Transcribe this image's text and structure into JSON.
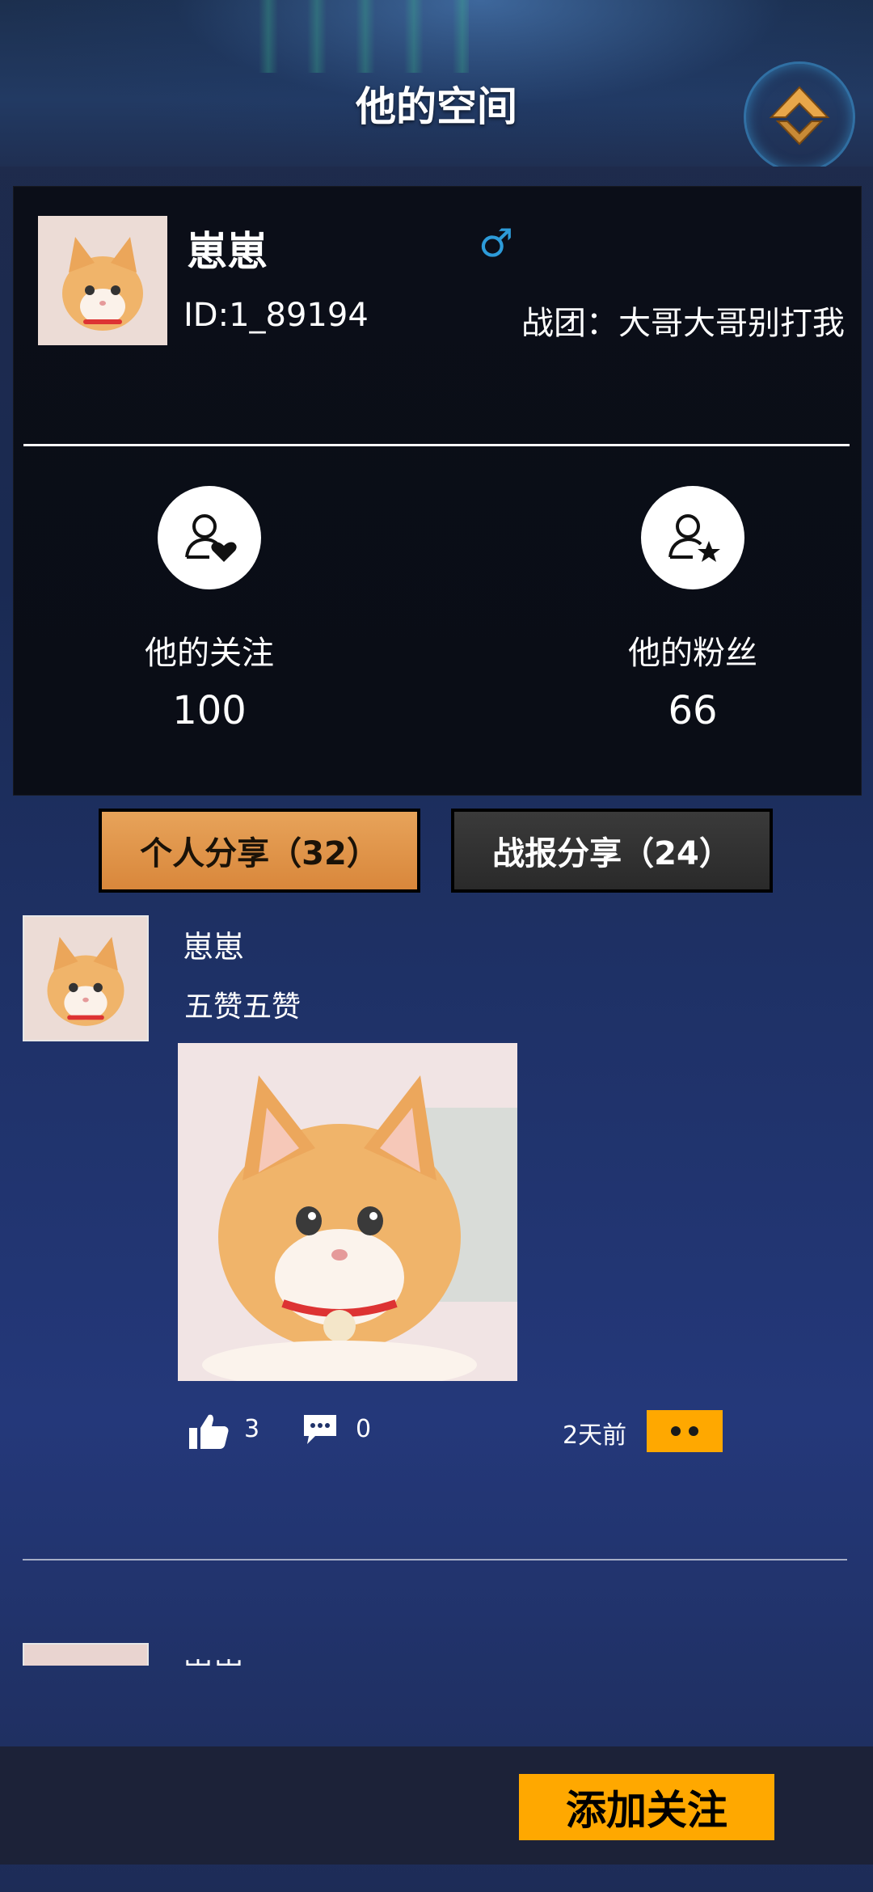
{
  "header": {
    "title": "他的空间",
    "home_icon": "home-diamond-icon"
  },
  "profile": {
    "name": "崽崽",
    "gender_icon": "male-symbol-icon",
    "gender_glyph": "♂",
    "id_text": "ID:1_89194",
    "clan_text": "战团：大哥大哥别打我",
    "following": {
      "icon": "user-heart-icon",
      "label": "他的关注",
      "value": "100"
    },
    "fans": {
      "icon": "user-star-icon",
      "label": "他的粉丝",
      "value": "66"
    }
  },
  "tabs": [
    {
      "label": "个人分享（32）",
      "active": true
    },
    {
      "label": "战报分享（24）",
      "active": false
    }
  ],
  "posts": [
    {
      "author": "崽崽",
      "text": "五赞五赞",
      "image": "kitten-photo",
      "likes": "3",
      "comments": "0",
      "time": "2天前"
    },
    {
      "author": "崽崽"
    }
  ],
  "footer": {
    "follow_label": "添加关注"
  },
  "colors": {
    "accent": "#ffa800",
    "tab_active": "#e19a4d",
    "gender": "#2d9bd9",
    "card_bg": "#0b0e18"
  }
}
